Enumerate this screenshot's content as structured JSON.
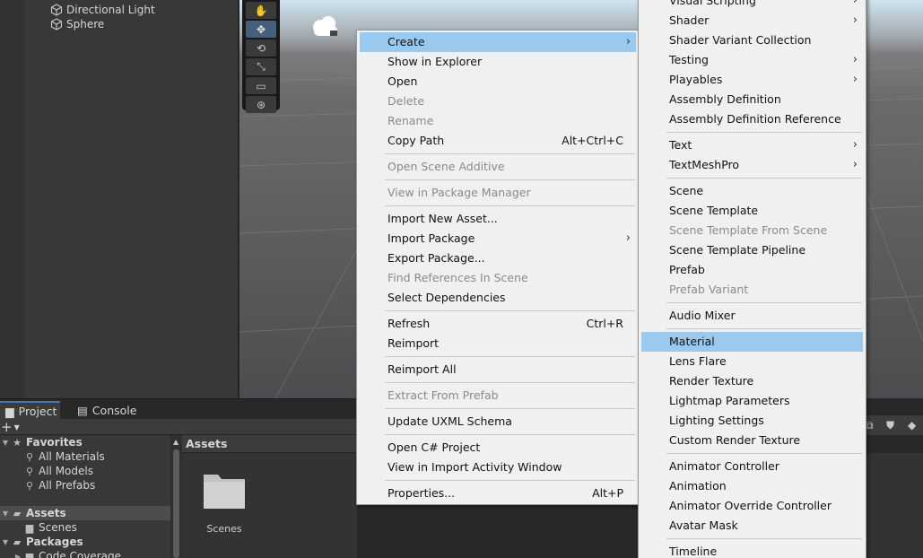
{
  "hierarchy": {
    "items": [
      {
        "label": "Directional Light",
        "icon": "gameobject-icon"
      },
      {
        "label": "Sphere",
        "icon": "gameobject-icon"
      }
    ]
  },
  "scene": {
    "tools": [
      "hand-tool",
      "move-tool",
      "rotate-tool",
      "scale-tool",
      "rect-tool",
      "transform-tool"
    ],
    "active_tool": "move-tool"
  },
  "bottom_panel": {
    "tabs": [
      {
        "label": "Project",
        "icon": "folder-icon",
        "active": true
      },
      {
        "label": "Console",
        "icon": "console-icon",
        "active": false
      }
    ],
    "add_button": "+"
  },
  "project_tree": {
    "rows": [
      {
        "label": "Favorites",
        "bold": true,
        "icon": "star",
        "arrow": "▼"
      },
      {
        "label": "All Materials",
        "bold": false,
        "icon": "search",
        "arrow": ""
      },
      {
        "label": "All Models",
        "bold": false,
        "icon": "search",
        "arrow": ""
      },
      {
        "label": "All Prefabs",
        "bold": false,
        "icon": "search",
        "arrow": ""
      },
      {
        "label": "Assets",
        "bold": true,
        "icon": "folder-open",
        "arrow": "▼"
      },
      {
        "label": "Scenes",
        "bold": false,
        "icon": "folder",
        "arrow": ""
      },
      {
        "label": "Packages",
        "bold": true,
        "icon": "folder-open",
        "arrow": "▼"
      },
      {
        "label": "Code Coverage",
        "bold": false,
        "icon": "folder",
        "arrow": "▶"
      }
    ]
  },
  "assets": {
    "header": "Assets",
    "folders": [
      {
        "label": "Scenes"
      }
    ]
  },
  "context_menu": {
    "items": [
      {
        "label": "Create",
        "arrow": "›",
        "highlighted": true
      },
      {
        "label": "Show in Explorer"
      },
      {
        "label": "Open"
      },
      {
        "label": "Delete",
        "disabled": true
      },
      {
        "label": "Rename",
        "disabled": true
      },
      {
        "label": "Copy Path",
        "shortcut": "Alt+Ctrl+C"
      },
      {
        "separator": true
      },
      {
        "label": "Open Scene Additive",
        "disabled": true
      },
      {
        "separator": true
      },
      {
        "label": "View in Package Manager",
        "disabled": true
      },
      {
        "separator": true
      },
      {
        "label": "Import New Asset..."
      },
      {
        "label": "Import Package",
        "arrow": "›"
      },
      {
        "label": "Export Package..."
      },
      {
        "label": "Find References In Scene",
        "disabled": true
      },
      {
        "label": "Select Dependencies"
      },
      {
        "separator": true
      },
      {
        "label": "Refresh",
        "shortcut": "Ctrl+R"
      },
      {
        "label": "Reimport"
      },
      {
        "separator": true
      },
      {
        "label": "Reimport All"
      },
      {
        "separator": true
      },
      {
        "label": "Extract From Prefab",
        "disabled": true
      },
      {
        "separator": true
      },
      {
        "label": "Update UXML Schema"
      },
      {
        "separator": true
      },
      {
        "label": "Open C# Project"
      },
      {
        "label": "View in Import Activity Window"
      },
      {
        "separator": true
      },
      {
        "label": "Properties...",
        "shortcut": "Alt+P"
      }
    ]
  },
  "create_submenu": {
    "items": [
      {
        "label": "Visual Scripting",
        "arrow": "›"
      },
      {
        "label": "Shader",
        "arrow": "›"
      },
      {
        "label": "Shader Variant Collection"
      },
      {
        "label": "Testing",
        "arrow": "›"
      },
      {
        "label": "Playables",
        "arrow": "›"
      },
      {
        "label": "Assembly Definition"
      },
      {
        "label": "Assembly Definition Reference"
      },
      {
        "separator": true
      },
      {
        "label": "Text",
        "arrow": "›"
      },
      {
        "label": "TextMeshPro",
        "arrow": "›"
      },
      {
        "separator": true
      },
      {
        "label": "Scene"
      },
      {
        "label": "Scene Template"
      },
      {
        "label": "Scene Template From Scene",
        "disabled": true
      },
      {
        "label": "Scene Template Pipeline"
      },
      {
        "label": "Prefab"
      },
      {
        "label": "Prefab Variant",
        "disabled": true
      },
      {
        "separator": true
      },
      {
        "label": "Audio Mixer"
      },
      {
        "separator": true
      },
      {
        "label": "Material",
        "highlighted": true
      },
      {
        "label": "Lens Flare"
      },
      {
        "label": "Render Texture"
      },
      {
        "label": "Lightmap Parameters"
      },
      {
        "label": "Lighting Settings"
      },
      {
        "label": "Custom Render Texture"
      },
      {
        "separator": true
      },
      {
        "label": "Animator Controller"
      },
      {
        "label": "Animation"
      },
      {
        "label": "Animator Override Controller"
      },
      {
        "label": "Avatar Mask"
      },
      {
        "separator": true
      },
      {
        "label": "Timeline"
      }
    ]
  },
  "colors": {
    "menu_bg": "#f0f0f0",
    "menu_highlight": "#99c9ef",
    "disabled_text": "#8a8a8a",
    "accent_blue": "#3a79bb"
  }
}
